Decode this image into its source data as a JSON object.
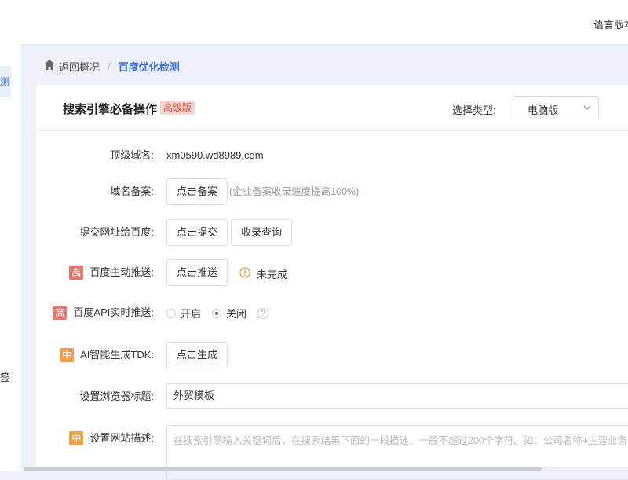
{
  "topbar": {
    "language_label": "语言版本"
  },
  "sidebar": {
    "active_item_label": "测",
    "sign_item_label": "签"
  },
  "breadcrumb": {
    "back_label": "返回概况",
    "current_label": "百度优化检测"
  },
  "card": {
    "title": "搜索引擎必备操作",
    "title_badge": "高级版",
    "type_label": "选择类型:",
    "type_value": "电脑版"
  },
  "rows": {
    "domain": {
      "label": "顶级域名:",
      "value": "xm0590.wd8989.com"
    },
    "filing": {
      "label": "域名备案:",
      "button": "点击备案",
      "hint": "(企业备案收录速度提高100%)"
    },
    "submit": {
      "label": "提交网址给百度:",
      "button_submit": "点击提交",
      "button_query": "收录查询"
    },
    "push": {
      "tag": "高",
      "label": "百度主动推送:",
      "button": "点击推送",
      "status": "未完成"
    },
    "api_push": {
      "tag": "高",
      "label": "百度API实时推送:",
      "option_on": "开启",
      "option_off": "关闭",
      "selected": "关闭",
      "help": "?"
    },
    "tdk": {
      "tag": "中",
      "label": "AI智能生成TDK:",
      "button": "点击生成"
    },
    "browser_title": {
      "label": "设置浏览器标题:",
      "value": "外贸模板"
    },
    "site_desc": {
      "tag": "中",
      "label": "设置网站描述:",
      "placeholder": "在搜索引擎输入关键词后，在搜索结果下面的一段描述。一般不超过200个字符。如：公司名称+主营业务+宣"
    }
  },
  "colors": {
    "accent": "#3c6ee0",
    "high_tag": "#e8766a",
    "mid_tag": "#f0a048",
    "badge_text": "#e0533e",
    "warning": "#f0a048"
  },
  "icons": {
    "home": "home-icon",
    "chevron": "chevron-down-icon",
    "warning": "warning-icon",
    "help": "help-icon"
  },
  "scrollbar": {
    "horizontal_position": 0.0
  }
}
